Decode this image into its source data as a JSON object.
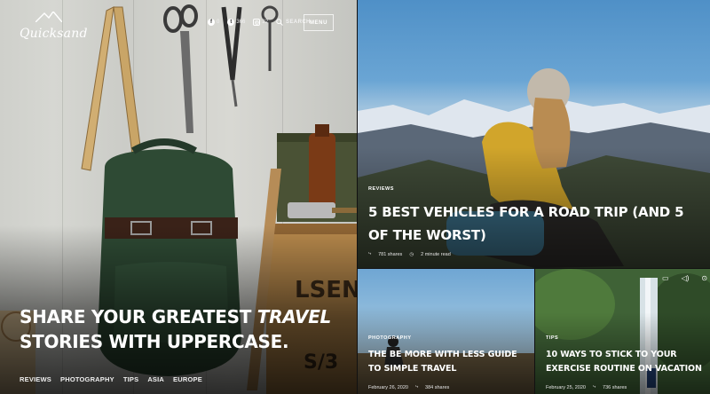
{
  "brand": {
    "logo_text": "Quicksand"
  },
  "header": {
    "social": [
      {
        "icon": "facebook-icon",
        "glyph": "f",
        "count": "0"
      },
      {
        "icon": "twitter-icon",
        "glyph": "t",
        "count": "366"
      },
      {
        "icon": "instagram-icon",
        "glyph": "◎",
        "count": "22"
      }
    ],
    "search_label": "SEARCH",
    "menu_label": "MENU"
  },
  "hero": {
    "title_before": "SHARE YOUR GREATEST ",
    "title_emphasis": "TRAVEL",
    "title_after": " STORIES WITH UPPERCASE.",
    "tags": [
      "REVIEWS",
      "PHOTOGRAPHY",
      "TIPS",
      "ASIA",
      "EUROPE"
    ]
  },
  "feature": {
    "category": "REVIEWS",
    "title": "5 BEST VEHICLES FOR A ROAD TRIP (AND 5 OF THE WORST)",
    "shares": "781 shares",
    "read_time": "2 minute read"
  },
  "cards": [
    {
      "category": "PHOTOGRAPHY",
      "title": "THE BE MORE WITH LESS GUIDE TO SIMPLE TRAVEL",
      "date": "February 26, 2020",
      "shares": "384 shares"
    },
    {
      "category": "TIPS",
      "title": "10 WAYS TO STICK TO YOUR EXERCISE ROUTINE ON VACATION",
      "date": "February 25, 2020",
      "shares": "736 shares"
    }
  ],
  "video_controls": [
    "play-icon",
    "volume-icon",
    "more-icon"
  ]
}
